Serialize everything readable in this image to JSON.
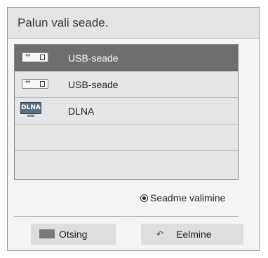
{
  "dialog": {
    "title": "Palun vali seade."
  },
  "devices": [
    {
      "label": "USB-seade",
      "icon": "usb-icon",
      "selected": true
    },
    {
      "label": "USB-seade",
      "icon": "usb-icon",
      "selected": false
    },
    {
      "label": "DLNA",
      "icon": "dlna-icon",
      "selected": false,
      "icon_text": "DLNA"
    },
    {
      "label": "",
      "selected": false
    },
    {
      "label": "",
      "selected": false
    }
  ],
  "hint": {
    "text": "Seadme valimine",
    "icon": "radio-select-icon"
  },
  "footer": {
    "search_label": "Otsing",
    "back_label": "Eelmine"
  },
  "colors": {
    "selected_row": "#6e6e6e",
    "list_background": "#e6e6e6",
    "dialog_background": "#f4f4f4"
  }
}
